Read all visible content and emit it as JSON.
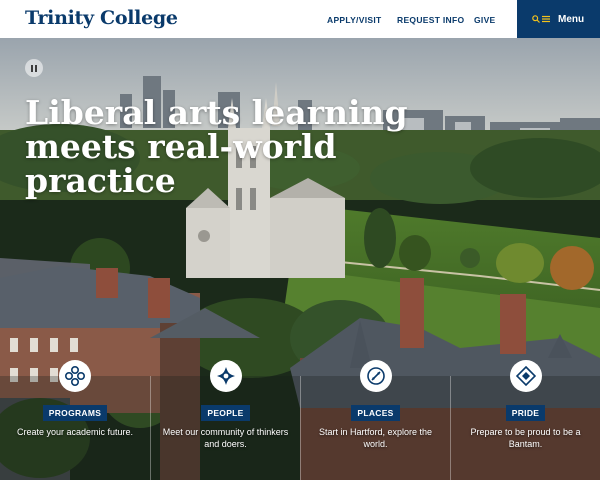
{
  "header": {
    "logo": "Trinity College",
    "nav": [
      {
        "label": "APPLY/VISIT"
      },
      {
        "label": "REQUEST INFO"
      },
      {
        "label": "GIVE"
      }
    ],
    "menu_label": "Menu",
    "menu_icons": [
      "search-icon",
      "menu-lines-icon"
    ]
  },
  "hero": {
    "headline": "Liberal arts learning meets real-world practice",
    "pause_icon": "pause-icon"
  },
  "cards": [
    {
      "icon": "programs-icon",
      "badge": "PROGRAMS",
      "text": "Create your academic future."
    },
    {
      "icon": "people-icon",
      "badge": "PEOPLE",
      "text": "Meet our community of thinkers and doers."
    },
    {
      "icon": "places-icon",
      "badge": "PLACES",
      "text": "Start in Hartford, explore the world."
    },
    {
      "icon": "pride-icon",
      "badge": "PRIDE",
      "text": "Prepare to be proud to be a Bantam."
    }
  ],
  "colors": {
    "brand_navy": "#0a3a6b",
    "header_bg": "#ffffff"
  }
}
